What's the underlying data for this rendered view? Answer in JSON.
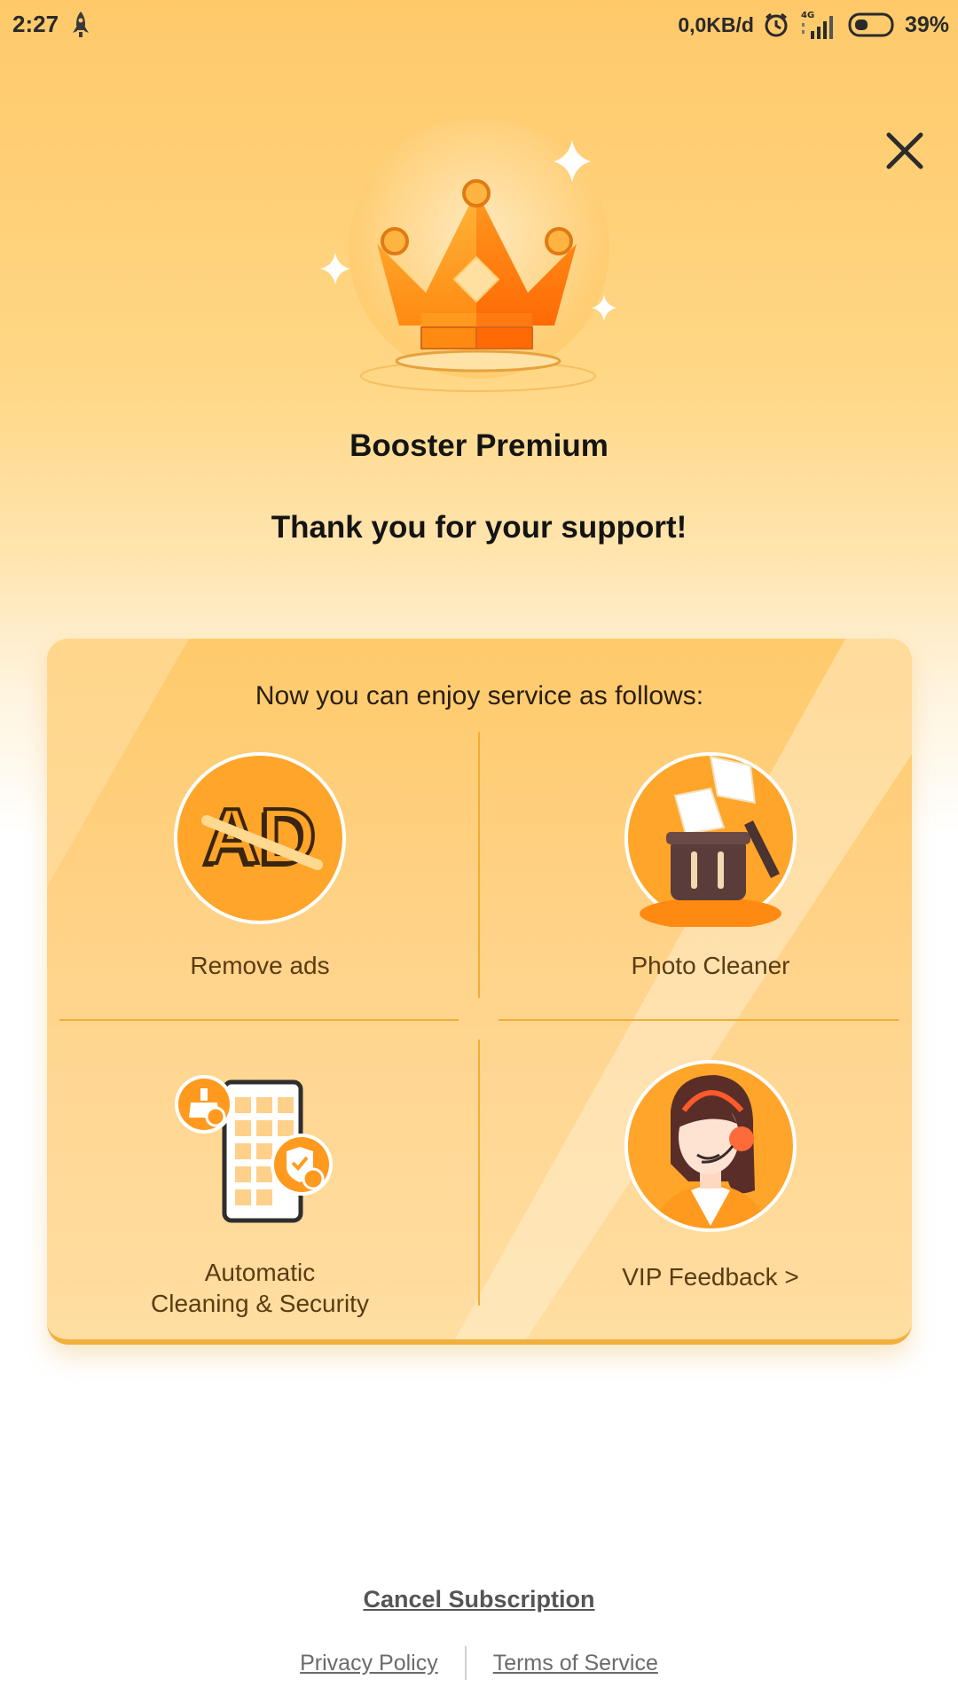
{
  "status_bar": {
    "time": "2:27",
    "network_speed": "0,0KB/d",
    "network_type": "4G",
    "battery_percent": "39%",
    "battery_level": 0.39,
    "icons": [
      "rocket-icon",
      "alarm-icon",
      "signal-icon",
      "battery-icon"
    ]
  },
  "header": {
    "close_icon": "close-icon",
    "title": "Booster Premium",
    "subtitle": "Thank you for your support!"
  },
  "card": {
    "heading": "Now you can enjoy service as follows:",
    "features": [
      {
        "label": "Remove ads",
        "icon": "ad-block-icon",
        "icon_text": "AD"
      },
      {
        "label": "Photo Cleaner",
        "icon": "photo-cleaner-icon"
      },
      {
        "label_line1": "Automatic",
        "label_line2": "Cleaning & Security",
        "icon": "auto-clean-security-icon"
      },
      {
        "label": "VIP Feedback >",
        "icon": "vip-support-agent-icon"
      }
    ]
  },
  "footer": {
    "cancel": "Cancel Subscription",
    "privacy": "Privacy Policy",
    "terms": "Terms of Service"
  },
  "colors": {
    "accent_orange": "#ff9a1f",
    "card_gold": "#ffca6b",
    "divider": "#f2ae32",
    "label_brown": "#5c3b12"
  }
}
